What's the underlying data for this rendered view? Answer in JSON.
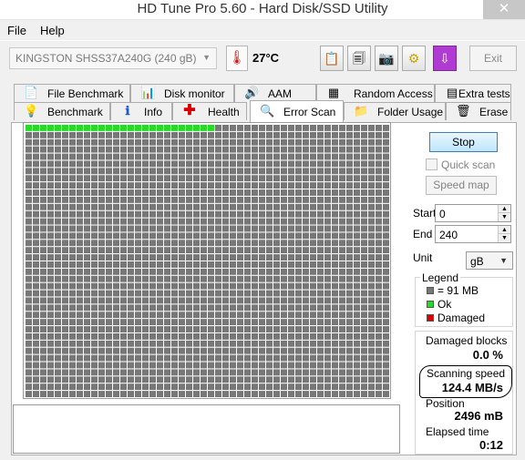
{
  "window": {
    "title": "HD Tune Pro 5.60 - Hard Disk/SSD Utility",
    "close_glyph": "✕"
  },
  "menu": {
    "file": "File",
    "help": "Help"
  },
  "toolbar": {
    "drive": "KINGSTON SHSS37A240G (240 gB)",
    "temperature": "27°C",
    "exit_label": "Exit",
    "icons": [
      "copy-text-icon",
      "copy-screenshot-icon",
      "camera-icon",
      "options-icon",
      "save-down-icon"
    ]
  },
  "tabs_top": [
    {
      "label": "File Benchmark",
      "icon": "file-benchmark-icon"
    },
    {
      "label": "Disk monitor",
      "icon": "disk-monitor-icon"
    },
    {
      "label": "AAM",
      "icon": "speaker-icon"
    },
    {
      "label": "Random Access",
      "icon": "random-access-icon"
    },
    {
      "label": "Extra tests",
      "icon": "extra-tests-icon"
    }
  ],
  "tabs_bottom": [
    {
      "label": "Benchmark",
      "icon": "lightbulb-icon"
    },
    {
      "label": "Info",
      "icon": "info-icon"
    },
    {
      "label": "Health",
      "icon": "health-cross-icon"
    },
    {
      "label": "Error Scan",
      "icon": "magnifier-icon",
      "active": true
    },
    {
      "label": "Folder Usage",
      "icon": "folder-icon"
    },
    {
      "label": "Erase",
      "icon": "trash-icon"
    }
  ],
  "scan": {
    "columns": 50,
    "rows": 38,
    "scanned_blocks": 26,
    "colors": {
      "unscanned": "#777777",
      "ok": "#22dd22",
      "damaged": "#dd0000"
    }
  },
  "controls": {
    "stop_label": "Stop",
    "quick_scan_label": "Quick scan",
    "speed_map_label": "Speed map",
    "start_label": "Start",
    "start_value": "0",
    "end_label": "End",
    "end_value": "240",
    "unit_label": "Unit",
    "unit_value": "gB"
  },
  "legend": {
    "title": "Legend",
    "block_size": "= 91 MB",
    "ok": "Ok",
    "damaged": "Damaged"
  },
  "stats": {
    "damaged_blocks_label": "Damaged blocks",
    "damaged_blocks_value": "0.0 %",
    "scanning_speed_label": "Scanning speed",
    "scanning_speed_value": "124.4 MB/s",
    "position_label": "Position",
    "position_value": "2496 mB",
    "elapsed_label": "Elapsed time",
    "elapsed_value": "0:12"
  }
}
